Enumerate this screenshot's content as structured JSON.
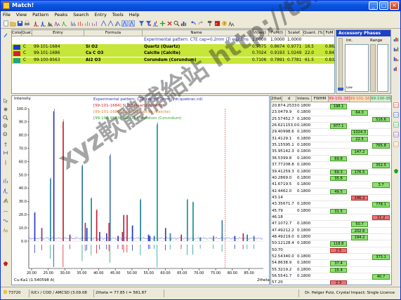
{
  "window": {
    "title": "Match!",
    "min": "_",
    "max": "□",
    "close": "×"
  },
  "menu": [
    "File",
    "View",
    "Pattern",
    "Peaks",
    "Search",
    "Entry",
    "Tools",
    "Help"
  ],
  "matchlist": {
    "columns": [
      "Color",
      "Qual.",
      "Entry",
      "Formula",
      "Name",
      "I/I(sec)",
      "FoM(I)",
      "Scalef.",
      "Quant. (%)",
      "FoM"
    ],
    "rows": [
      {
        "qual": "",
        "entry": "",
        "formula": "",
        "name": "Experimental pattern: CTE cap=0.2mm (Ti ed2.fms ydr. quebrac.cd)",
        "iis": "1.0000",
        "fomi": "1.0000",
        "scale": "1.0000",
        "quant": "",
        "fom": "",
        "color": "#ffffff",
        "bg": "#ffffff"
      },
      {
        "qual": "C",
        "entry": "99-101-1684",
        "formula": "Si O2",
        "name": "Quartz (Quartz)",
        "iis": "0.7075",
        "fomi": "0.8674",
        "scale": "0.9771",
        "quant": "16.5",
        "fom": "0.8622",
        "color": "#2038d0",
        "bg": "#c6e63a"
      },
      {
        "qual": "C",
        "entry": "99-101-1686",
        "formula": "Ca C O3",
        "name": "Calcite (Calcite)",
        "iis": "0.7024",
        "fomi": "0.9193",
        "scale": "1.0249",
        "quant": "22.0",
        "fom": "0.8474",
        "color": "#d8202a",
        "bg": "#c6e63a"
      },
      {
        "qual": "C",
        "entry": "99-100-9563",
        "formula": "Al2 O3",
        "name": "Corundum (Corundum)",
        "iis": "0.7106",
        "fomi": "0.7891",
        "fomi2": "",
        "scale": "0.7781",
        "quant": "61.5",
        "fom": "0.8327",
        "color": "#20a090",
        "bg": "#c6e63a"
      }
    ]
  },
  "accessory": {
    "tab": "Accessory Phases",
    "int_label": "Int.",
    "range_label": "Range",
    "low_label": "Low"
  },
  "chart": {
    "ylabel": "Intensity",
    "legend": [
      {
        "text": "Experimental pattern: CTE cap=0.2mm (ydr.quebrac.cd)",
        "color": "#3030b0"
      },
      {
        "text": "[99-101-1684] Si O2 Quartz (Quartz)",
        "color": "#d02020"
      },
      {
        "text": "[99-101-1686] Ca C O3 Calcite (Calcite)",
        "color": "#e08030"
      },
      {
        "text": "[99-100-9563] Al2 O3 Corundum (Corundum)",
        "color": "#30a030"
      }
    ],
    "yticks": [
      "100.0",
      "90.0",
      "80.0",
      "70.0",
      "60.0",
      "50.0",
      "40.0",
      "30.0",
      "20.0",
      "10.0",
      "0.0"
    ],
    "xticks": [
      "20.00",
      "25.00",
      "30.00",
      "35.00",
      "40.00",
      "45.00",
      "50.00",
      "55.00",
      "60.00",
      "65.00",
      "70.00",
      "75.00",
      "80.00",
      "85.00"
    ],
    "xunit": "2theta",
    "wavelength": "Cu-Ka1 (1.540598 A)"
  },
  "peaks": {
    "columns": [
      "2theta",
      "d",
      "Intens.",
      "FWHM",
      "99-101-1684",
      "99-101-1686",
      "99-100-9563"
    ],
    "rows": [
      {
        "t": "20.87",
        "d": "4.2533",
        "i": "0.1800",
        "q": "198.1",
        "c": "",
        "a": ""
      },
      {
        "t": "23.04",
        "d": "79.9",
        "i": "0.1800",
        "q": "",
        "c": "64.0",
        "a": ""
      },
      {
        "t": "25.57",
        "d": "452.7",
        "i": "0.1800",
        "q": "",
        "c": "",
        "a": "516.6"
      },
      {
        "t": "26.62",
        "d": "1153.0",
        "i": "0.1800",
        "q": "977.1",
        "c": "",
        "a": ""
      },
      {
        "t": "29.40",
        "d": "998.6",
        "i": "0.1800",
        "q": "",
        "c": "1024.3",
        "a": ""
      },
      {
        "t": "31.41",
        "d": "29.1",
        "i": "0.1800",
        "q": "",
        "c": "22.5",
        "a": ""
      },
      {
        "t": "35.15",
        "d": "595.1",
        "i": "0.1800",
        "q": "",
        "c": "",
        "a": "765.8"
      },
      {
        "t": "35.95",
        "d": "142.3",
        "i": "0.1800",
        "q": "",
        "c": "147.2",
        "a": ""
      },
      {
        "t": "36.53",
        "d": "99.8",
        "i": "0.1800",
        "q": "69.8",
        "c": "",
        "a": ""
      },
      {
        "t": "37.77",
        "d": "208.8",
        "i": "0.1800",
        "q": "",
        "c": "",
        "a": "352.5"
      },
      {
        "t": "39.41",
        "d": "259.3",
        "i": "0.1800",
        "q": "69.3",
        "c": "176.5",
        "a": ""
      },
      {
        "t": "40.28",
        "d": "69.0",
        "i": "0.1800",
        "q": "35.8",
        "c": "",
        "a": ""
      },
      {
        "t": "41.67",
        "d": "19.5",
        "i": "0.1800",
        "q": "",
        "c": "",
        "a": "3.7"
      },
      {
        "t": "42.44",
        "d": "62.0",
        "i": "0.1800",
        "q": "49.5",
        "c": "",
        "a": ""
      },
      {
        "t": "43.14",
        "d": "",
        "i": "",
        "q": "",
        "c": "146.2",
        "a": "",
        "cred": true
      },
      {
        "t": "43.35",
        "d": "671.7",
        "i": "0.1800",
        "q": "",
        "c": "",
        "a": "778.1"
      },
      {
        "t": "45.79",
        "d": "",
        "i": "0.1800",
        "q": "31.5",
        "c": "",
        "a": ""
      },
      {
        "t": "46.18",
        "d": "",
        "i": "",
        "q": "",
        "c": "",
        "a": "11.2",
        "ared": true
      },
      {
        "t": "47.10",
        "d": "72.7",
        "i": "0.1800",
        "q": "",
        "c": "50.7",
        "a": ""
      },
      {
        "t": "47.49",
        "d": "212.2",
        "i": "0.1800",
        "q": "",
        "c": "202.6",
        "a": ""
      },
      {
        "t": "48.49",
        "d": "219.0",
        "i": "0.1800",
        "q": "",
        "c": "194.2",
        "a": ""
      },
      {
        "t": "50.12",
        "d": "128.4",
        "i": "0.1800",
        "q": "118.8",
        "c": "",
        "a": ""
      },
      {
        "t": "50.70",
        "d": "",
        "i": "",
        "q": "2.5",
        "c": "",
        "a": "",
        "qred": true
      },
      {
        "t": "52.54",
        "d": "340.0",
        "i": "0.1800",
        "q": "",
        "c": "",
        "a": "373.1"
      },
      {
        "t": "54.86",
        "d": "38.9",
        "i": "0.1800",
        "q": "37.4",
        "c": "",
        "a": ""
      },
      {
        "t": "55.32",
        "d": "19.2",
        "i": "0.1800",
        "q": "15.4",
        "c": "",
        "a": ""
      },
      {
        "t": "56.55",
        "d": "41.7",
        "i": "0.1800",
        "q": "",
        "c": "",
        "a": "40.7"
      },
      {
        "t": "57.20",
        "d": "",
        "i": "",
        "q": "2.3",
        "c": "",
        "a": "",
        "qred": true
      }
    ]
  },
  "statusbar": {
    "count": "73720",
    "db": "IUCr / COD / AMCSD (3.09.08",
    "pos": "2theta = 77.85 I = 581.87",
    "copyright": "Dr. Helger Putz, Crystal Impact; Single Licence"
  },
  "watermark": "xyz軟體補給站 http://tsi.to",
  "colors": {
    "titlebar": "#0a55e0",
    "accent": "#1c40c8",
    "quartz": "#2038d0",
    "calcite": "#d8202a",
    "corundum": "#20a090",
    "match": "#c6e63a"
  }
}
